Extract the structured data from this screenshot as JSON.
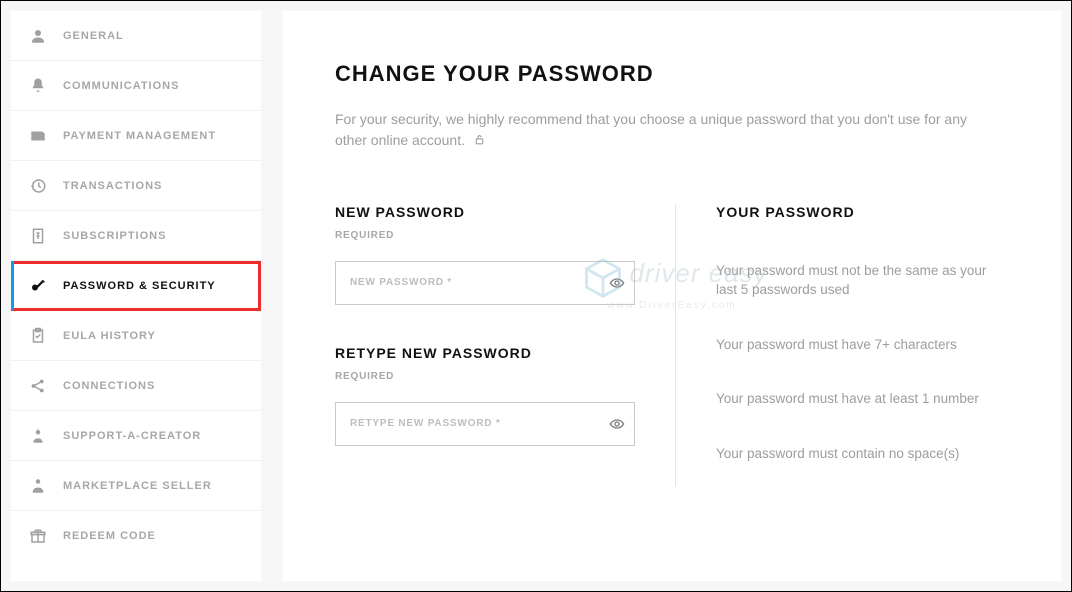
{
  "sidebar": {
    "items": [
      {
        "label": "GENERAL"
      },
      {
        "label": "COMMUNICATIONS"
      },
      {
        "label": "PAYMENT MANAGEMENT"
      },
      {
        "label": "TRANSACTIONS"
      },
      {
        "label": "SUBSCRIPTIONS"
      },
      {
        "label": "PASSWORD & SECURITY"
      },
      {
        "label": "EULA HISTORY"
      },
      {
        "label": "CONNECTIONS"
      },
      {
        "label": "SUPPORT-A-CREATOR"
      },
      {
        "label": "MARKETPLACE SELLER"
      },
      {
        "label": "REDEEM CODE"
      }
    ]
  },
  "main": {
    "title": "CHANGE YOUR PASSWORD",
    "description": "For your security, we highly recommend that you choose a unique password that you don't use for any other online account.",
    "newPassword": {
      "header": "NEW PASSWORD",
      "sub": "REQUIRED",
      "placeholder": "NEW PASSWORD *"
    },
    "retypePassword": {
      "header": "RETYPE NEW PASSWORD",
      "sub": "REQUIRED",
      "placeholder": "RETYPE NEW PASSWORD *"
    },
    "rules": {
      "header": "YOUR PASSWORD",
      "r1": "Your password must not be the same as your last 5 passwords used",
      "r2": "Your password must have 7+ characters",
      "r3": "Your password must have at least 1 number",
      "r4": "Your password must contain no space(s)"
    }
  },
  "watermark": {
    "brand": "driver easy",
    "url": "www.DriverEasy.com"
  }
}
